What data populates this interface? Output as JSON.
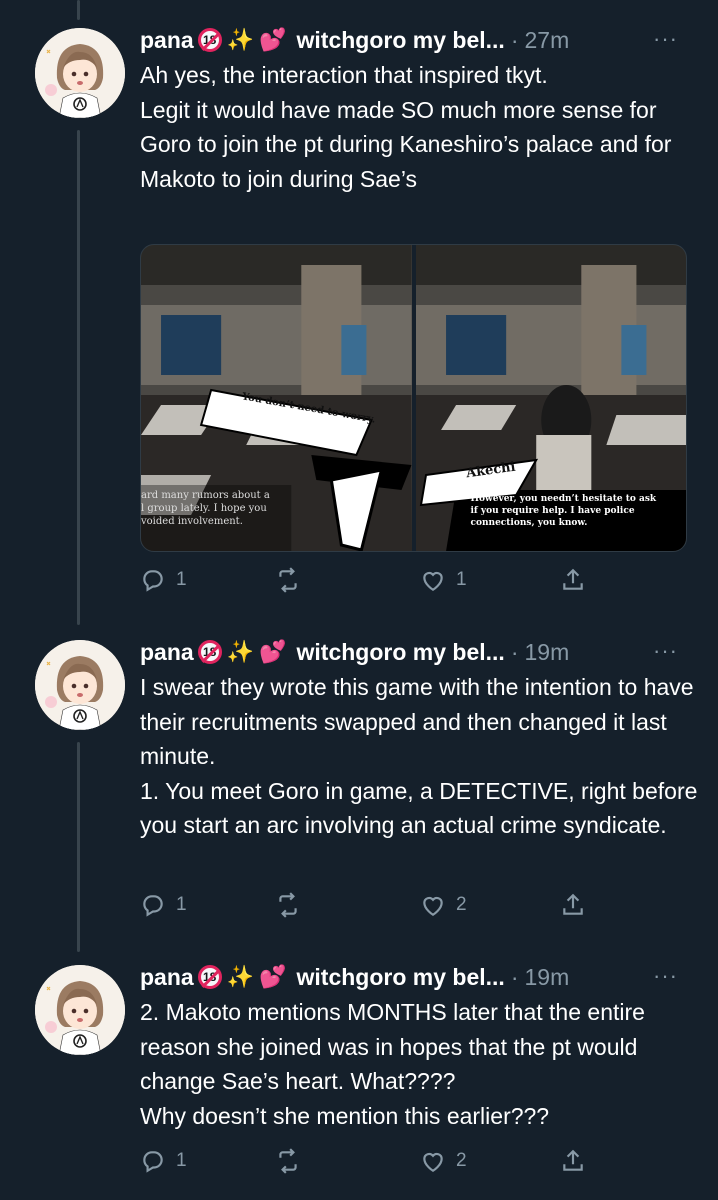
{
  "icons": {
    "reply": "reply-icon",
    "retweet": "retweet-icon",
    "like": "heart-icon",
    "share": "share-icon",
    "more": "more-icon"
  },
  "colors": {
    "background": "#15202b",
    "text": "#ffffff",
    "muted": "#8899a6",
    "thread_line": "#38444d"
  },
  "tweets": [
    {
      "display_name": "pana",
      "second_name": "witchgoro my bel...",
      "sep": "·",
      "time": "27m",
      "more": "···",
      "text": "Ah yes, the interaction that inspired tkyt.\nLegit it would have made SO much more sense for Goro to join the pt during Kaneshiro’s palace and for Makoto to join during Sae’s",
      "media": {
        "left": {
          "sign": "",
          "dialog": "You don’t need to worry.",
          "caption": "ard many rumors about a\nl group lately. I hope you\nvoided involvement."
        },
        "right": {
          "sign": "",
          "speaker": "Akechi",
          "caption": "However, you needn’t hesitate to ask\nif you require help. I have police\nconnections, you know."
        }
      },
      "replies": "1",
      "retweets": "",
      "likes": "1"
    },
    {
      "display_name": "pana",
      "second_name": "witchgoro my bel...",
      "sep": "·",
      "time": "19m",
      "more": "···",
      "text": "I swear they wrote this game with the intention to have their recruitments swapped and then changed it last minute.\n1. You meet Goro in game, a DETECTIVE, right before you start an arc involving an actual crime syndicate.",
      "replies": "1",
      "retweets": "",
      "likes": "2"
    },
    {
      "display_name": "pana",
      "second_name": "witchgoro my bel...",
      "sep": "·",
      "time": "19m",
      "more": "···",
      "text": "2. Makoto mentions MONTHS later that the entire reason she joined was in hopes that the pt would change Sae’s heart. What????\nWhy doesn’t she mention this earlier???",
      "replies": "1",
      "retweets": "",
      "likes": "2"
    }
  ]
}
